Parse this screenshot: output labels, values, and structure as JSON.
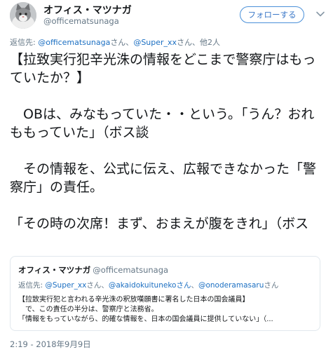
{
  "author": {
    "name": "オフィス・マツナガ",
    "handle": "@officematsunaga",
    "avatar_icon": "cat-avatar"
  },
  "follow_button": {
    "label": "フォローする"
  },
  "menu_icon": "chevron-down-icon",
  "reply": {
    "prefix": "返信先:",
    "links": [
      "@officematsunaga",
      "@Super_xx"
    ],
    "suffix_1": "さん、",
    "suffix_2": "さん、他2人"
  },
  "tweet_text": {
    "line_1": "【拉致実行犯辛光洙の情報をどこまで警察庁はもっていたか？】",
    "line_2": "　OBは、みなもっていた・・という。「うん？おれももっていた」（ボス談",
    "line_3": "　その情報を、公式に伝え、広報できなかった「警察庁」の責任。",
    "line_4": "「その時の次席！まず、おまえが腹をきれ」（ボス"
  },
  "quote": {
    "name": "オフィス・マツナガ",
    "handle": "@officematsunaga",
    "reply_prefix": "返信先:",
    "reply_link_1": "@Super_xx",
    "reply_mid_1": "さん、",
    "reply_link_2": "@akaidokuitunekoさん",
    "reply_mid_2": "、",
    "reply_link_3": "@onoderamasaru",
    "reply_suffix": "さん",
    "text_line_1": "【拉致実行犯と言われる辛光洙の釈放嘆願書に署名した日本の国会議員】",
    "text_line_2": "　で、この責任の半分は、警察庁と法務省。",
    "text_line_3": "「情報をもっていながら、的確な情報を、日本の国会議員に提供していない」（..."
  },
  "timestamp": "2:19 - 2018年9月9日",
  "colors": {
    "link": "#1b6fc2",
    "follow_border": "#4a90d9",
    "muted": "#657786"
  }
}
